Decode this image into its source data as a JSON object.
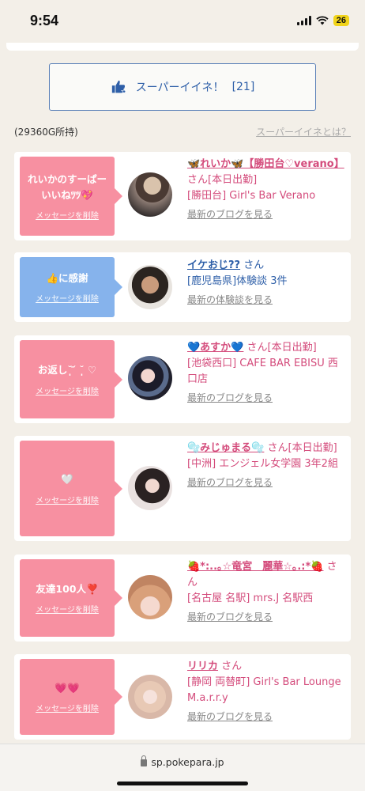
{
  "status": {
    "time": "9:54",
    "battery": "26"
  },
  "super_like_button": {
    "label": "スーパーイイネ！",
    "count": "[21]"
  },
  "gold_held": "(29360G所持)",
  "about_link": "スーパーイイネとは？",
  "delete_label": "メッセージを削除",
  "san_suffix": "さん",
  "cards": [
    {
      "message": "れいかのすーぱーいいねﾂﾂ💖",
      "name": "🦋れいか🦋【勝田台♡verano】",
      "tag": "[本日出勤]",
      "shop": "[勝田台] Girl's Bar Verano",
      "latest_link": "最新のブログを見る"
    },
    {
      "message": "👍に感謝",
      "name": "イケおじ??",
      "shop": "[鹿児島県]体験談 3件",
      "latest_link": "最新の体験談を見る"
    },
    {
      "message": "お返し˘̩̩̩ ᷄ ˘̩̩̩ ♡",
      "name": "💙あすか💙",
      "tag": "[本日出勤]",
      "shop": "[池袋西口] CAFE BAR EBISU 西口店",
      "latest_link": "最新のブログを見る"
    },
    {
      "message": "🤍",
      "name": "🫧みじゅまる🫧",
      "tag": "[本日出勤]",
      "shop": "[中洲] エンジェル女学園 3年2組",
      "latest_link": "最新のブログを見る"
    },
    {
      "message": "友達100人❣️",
      "name": "🍓*:..｡☆竜宮　麗華☆｡.:*🍓",
      "shop": "[名古屋 名駅] mrs.J 名駅西",
      "latest_link": "最新のブログを見る"
    },
    {
      "message": "💗💗",
      "name": "リリカ",
      "shop": "[静岡 両替町] Girl's Bar Lounge M.a.r.r.y",
      "latest_link": "最新のブログを見る"
    }
  ],
  "browser": {
    "url": "sp.pokepara.jp"
  }
}
